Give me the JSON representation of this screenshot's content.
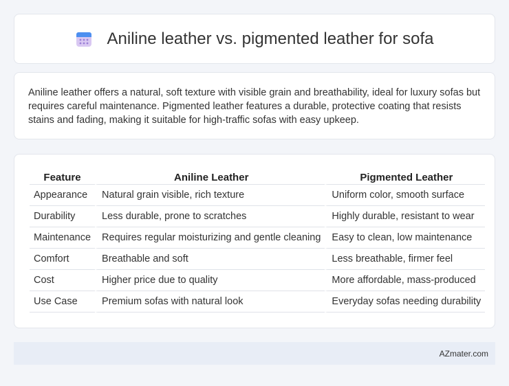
{
  "header": {
    "icon": "calendar-icon",
    "title": "Aniline leather vs. pigmented leather for sofa"
  },
  "summary": {
    "text": "Aniline leather offers a natural, soft texture with visible grain and breathability, ideal for luxury sofas but requires careful maintenance. Pigmented leather features a durable, protective coating that resists stains and fading, making it suitable for high-traffic sofas with easy upkeep."
  },
  "table": {
    "headers": [
      "Feature",
      "Aniline Leather",
      "Pigmented Leather"
    ],
    "rows": [
      [
        "Appearance",
        "Natural grain visible, rich texture",
        "Uniform color, smooth surface"
      ],
      [
        "Durability",
        "Less durable, prone to scratches",
        "Highly durable, resistant to wear"
      ],
      [
        "Maintenance",
        "Requires regular moisturizing and gentle cleaning",
        "Easy to clean, low maintenance"
      ],
      [
        "Comfort",
        "Breathable and soft",
        "Less breathable, firmer feel"
      ],
      [
        "Cost",
        "Higher price due to quality",
        "More affordable, mass-produced"
      ],
      [
        "Use Case",
        "Premium sofas with natural look",
        "Everyday sofas needing durability"
      ]
    ]
  },
  "footer": {
    "text": "AZmater.com"
  },
  "colors": {
    "icon_top": "#4d8ff0",
    "icon_body": "#d9c8f2",
    "icon_dots": "#9a7fd6"
  }
}
